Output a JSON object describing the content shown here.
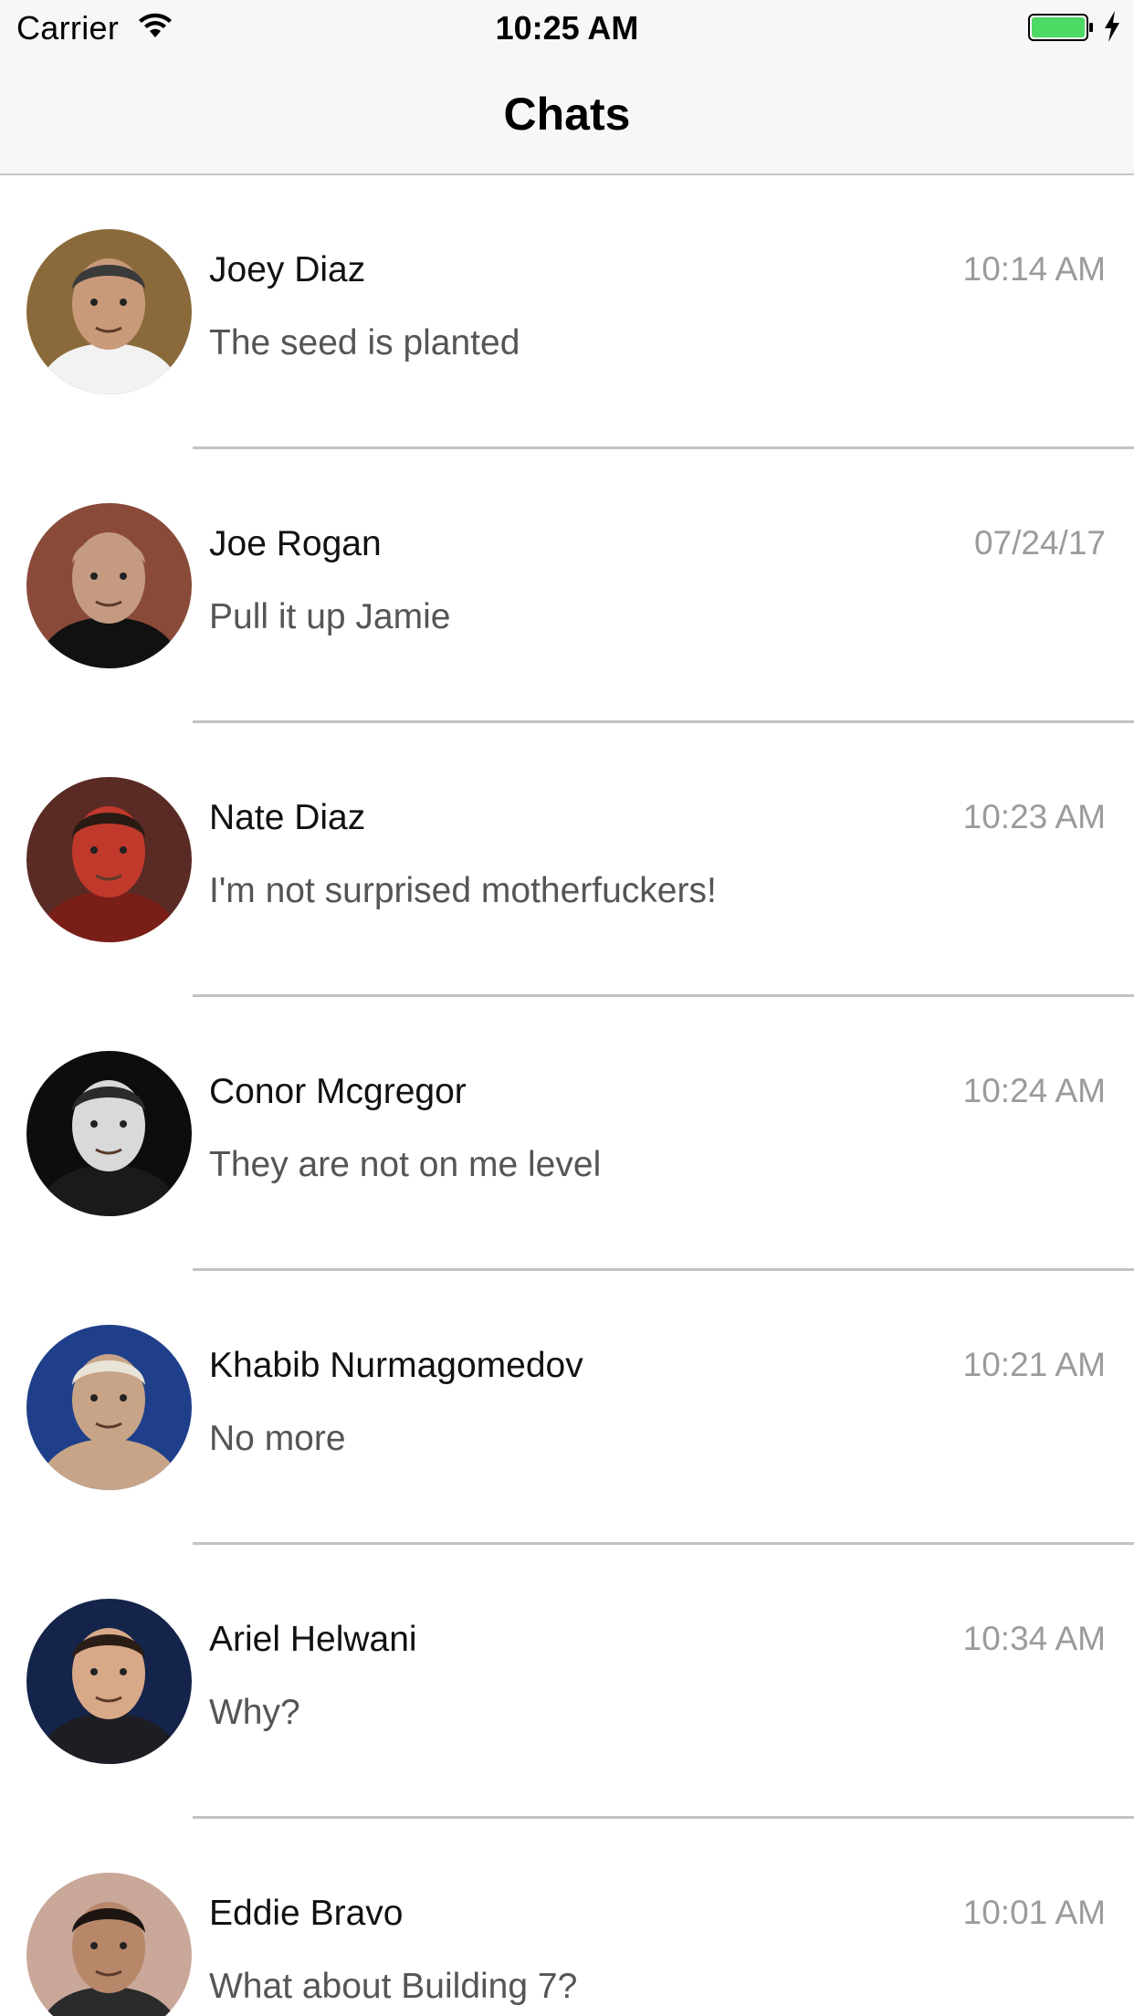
{
  "status_bar": {
    "carrier": "Carrier",
    "time": "10:25 AM",
    "battery_color": "#4cd964"
  },
  "nav": {
    "title": "Chats"
  },
  "chats": [
    {
      "name": "Joey Diaz",
      "time": "10:14 AM",
      "preview": "The seed is planted",
      "avatar": {
        "bg": "#8a6a3a",
        "skin": "#c99a7a",
        "shirt": "#f2f2f2",
        "hair": "#3a3a3a"
      }
    },
    {
      "name": "Joe Rogan",
      "time": "07/24/17",
      "preview": "Pull it up Jamie",
      "avatar": {
        "bg": "#8a4a3a",
        "skin": "#c49a82",
        "shirt": "#111111",
        "hair": "#c49a82"
      }
    },
    {
      "name": "Nate Diaz",
      "time": "10:23 AM",
      "preview": "I'm not surprised motherfuckers!",
      "avatar": {
        "bg": "#5a2a24",
        "skin": "#c0392b",
        "shirt": "#7a1f18",
        "hair": "#2a1a14"
      }
    },
    {
      "name": "Conor Mcgregor",
      "time": "10:24 AM",
      "preview": "They are not on me level",
      "avatar": {
        "bg": "#0d0d0d",
        "skin": "#d9d9d9",
        "shirt": "#1a1a1a",
        "hair": "#2b2b2b"
      }
    },
    {
      "name": "Khabib Nurmagomedov",
      "time": "10:21 AM",
      "preview": "No more",
      "avatar": {
        "bg": "#1f3f8a",
        "skin": "#c7a487",
        "shirt": "#c7a487",
        "hair": "#e9e4d8"
      }
    },
    {
      "name": "Ariel Helwani",
      "time": "10:34 AM",
      "preview": "Why?",
      "avatar": {
        "bg": "#14244a",
        "skin": "#d8a988",
        "shirt": "#1d1d24",
        "hair": "#2a1d16"
      }
    },
    {
      "name": "Eddie Bravo",
      "time": "10:01 AM",
      "preview": "What about Building 7?",
      "avatar": {
        "bg": "#c9a89a",
        "skin": "#b8876a",
        "shirt": "#2b2b2b",
        "hair": "#1b1410"
      }
    }
  ]
}
